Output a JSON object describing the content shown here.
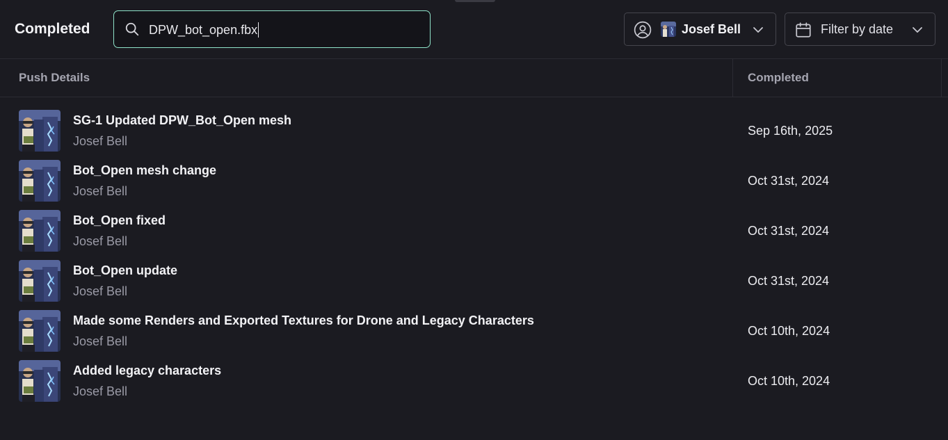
{
  "header": {
    "title": "Completed",
    "search": {
      "value": "DPW_bot_open.fbx",
      "placeholder": ""
    },
    "user_filter": {
      "name": "Josef Bell",
      "icon": "user-circle-icon"
    },
    "date_filter": {
      "label": "Filter by date",
      "icon": "calendar-icon"
    }
  },
  "table": {
    "columns": [
      "Push Details",
      "Completed"
    ],
    "rows": [
      {
        "title": "SG-1 Updated DPW_Bot_Open mesh",
        "author": "Josef Bell",
        "date": "Sep 16th, 2025"
      },
      {
        "title": "Bot_Open mesh change",
        "author": "Josef Bell",
        "date": "Oct 31st, 2024"
      },
      {
        "title": "Bot_Open fixed",
        "author": "Josef Bell",
        "date": "Oct 31st, 2024"
      },
      {
        "title": "Bot_Open update",
        "author": "Josef Bell",
        "date": "Oct 31st, 2024"
      },
      {
        "title": "Made some Renders and Exported Textures for Drone and Legacy Characters",
        "author": "Josef Bell",
        "date": "Oct 10th, 2024"
      },
      {
        "title": "Added legacy characters",
        "author": "Josef Bell",
        "date": "Oct 10th, 2024"
      }
    ]
  },
  "colors": {
    "background": "#1b1b21",
    "search_border": "#8fe3c9",
    "muted_text": "#9a9aa6"
  }
}
